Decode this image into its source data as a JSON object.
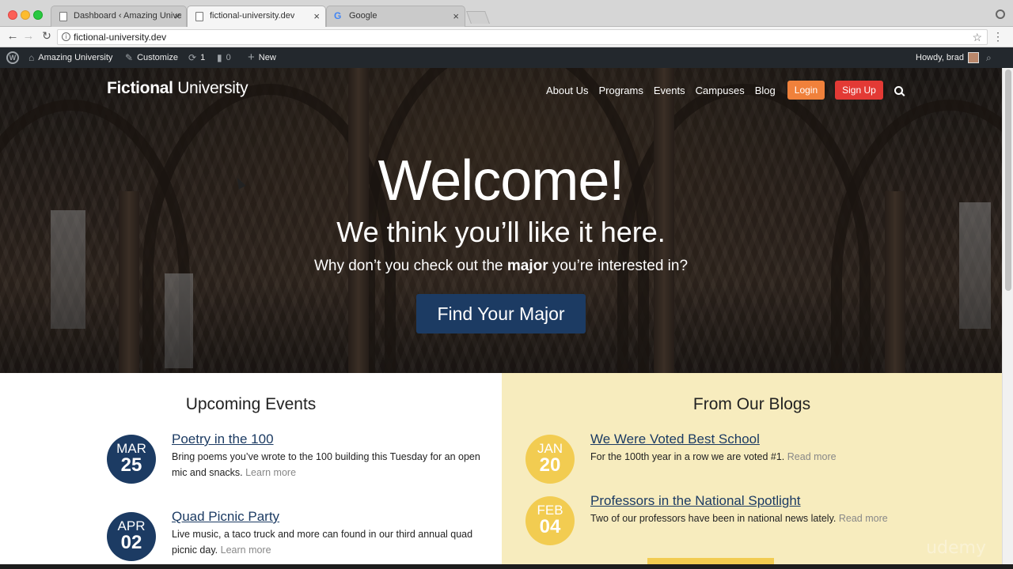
{
  "browser": {
    "tabs": [
      {
        "title": "Dashboard ‹ Amazing University",
        "active": false
      },
      {
        "title": "fictional-university.dev",
        "active": true
      },
      {
        "title": "Google",
        "active": false
      }
    ],
    "url": "fictional-university.dev"
  },
  "adminbar": {
    "site_name": "Amazing University",
    "customize": "Customize",
    "updates_count": "1",
    "comments_count": "0",
    "new": "New",
    "howdy": "Howdy, brad"
  },
  "site": {
    "logo_bold": "Fictional",
    "logo_light": "University",
    "nav": [
      "About Us",
      "Programs",
      "Events",
      "Campuses",
      "Blog"
    ],
    "login": "Login",
    "signup": "Sign Up"
  },
  "hero": {
    "welcome": "Welcome!",
    "tagline": "We think you’ll like it here.",
    "question_pre": "Why don’t you check out the ",
    "question_bold": "major",
    "question_post": " you’re interested in?",
    "cta": "Find Your Major"
  },
  "events": {
    "title": "Upcoming Events",
    "items": [
      {
        "month": "MAR",
        "day": "25",
        "title": "Poetry in the 100",
        "desc": "Bring poems you’ve wrote to the 100 building this Tuesday for an open mic and snacks.",
        "more": "Learn more"
      },
      {
        "month": "APR",
        "day": "02",
        "title": "Quad Picnic Party",
        "desc": "Live music, a taco truck and more can found in our third annual quad picnic day.",
        "more": "Learn more"
      }
    ]
  },
  "blogs": {
    "title": "From Our Blogs",
    "items": [
      {
        "month": "JAN",
        "day": "20",
        "title": "We Were Voted Best School",
        "desc": "For the 100th year in a row we are voted #1.",
        "more": "Read more"
      },
      {
        "month": "FEB",
        "day": "04",
        "title": "Professors in the National Spotlight",
        "desc": "Two of our professors have been in national news lately.",
        "more": "Read more"
      }
    ]
  },
  "watermark": "udemy",
  "colors": {
    "navy": "#1c3b63",
    "login_orange": "#f0813b",
    "signup_red": "#e33a35",
    "blog_yellow": "#f2cc51",
    "blog_bg": "#f7ecbe"
  }
}
